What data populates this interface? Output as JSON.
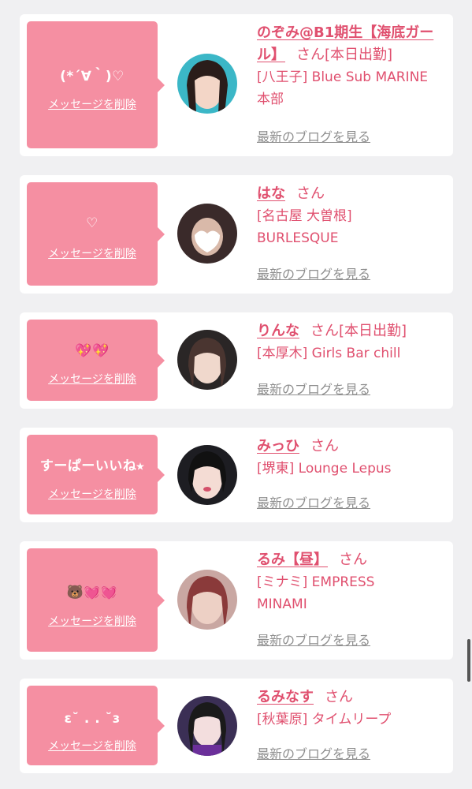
{
  "delete_label": "メッセージを削除",
  "blog_label": "最新のブログを見る",
  "san": "さん",
  "colors": {
    "accent": "#e0506f",
    "bubble": "#f58fa2",
    "link_gray": "#8e8e8e"
  },
  "cards": [
    {
      "message": "(*´∀｀)♡",
      "name": "のぞみ@B1期生【海底ガール】",
      "status": "[本日出勤]",
      "shop": "[八王子] Blue Sub MARINE 本部"
    },
    {
      "message": "♡",
      "name": "はな",
      "status": "",
      "shop": "[名古屋 大曽根] BURLESQUE"
    },
    {
      "message": "💖💖",
      "name": "りんな",
      "status": "[本日出勤]",
      "shop": "[本厚木] Girls Bar chill"
    },
    {
      "message": "すーぱーいいね⭑",
      "name": "みっひ",
      "status": "",
      "shop": "[堺東] Lounge Lepus"
    },
    {
      "message": "🐻💓💓",
      "name": "るみ【昼】",
      "status": "",
      "shop": "[ミナミ] EMPRESS MINAMI"
    },
    {
      "message": "ɛ˘ . . ˘ɜ",
      "name": "るみなす",
      "status": "",
      "shop": "[秋葉原] タイムリープ"
    }
  ]
}
